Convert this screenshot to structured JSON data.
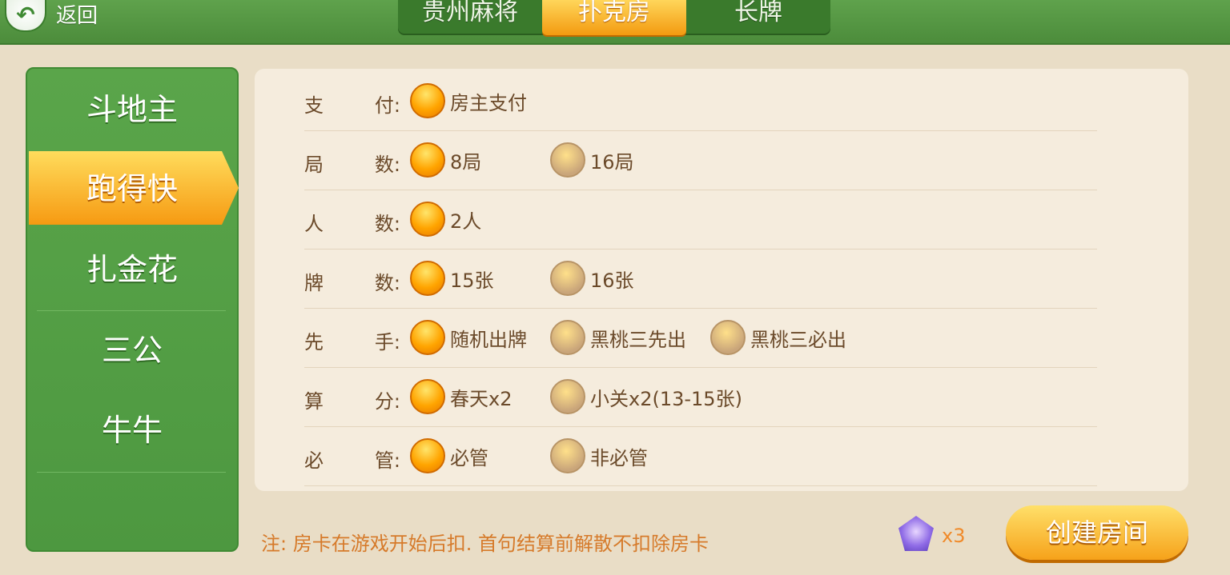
{
  "header": {
    "back_label": "返回",
    "tabs": [
      {
        "label": "贵州麻将",
        "active": false
      },
      {
        "label": "扑克房",
        "active": true
      },
      {
        "label": "长牌",
        "active": false
      }
    ]
  },
  "sidebar": {
    "items": [
      {
        "label": "斗地主",
        "active": false
      },
      {
        "label": "跑得快",
        "active": true
      },
      {
        "label": "扎金花",
        "active": false
      },
      {
        "label": "三公",
        "active": false
      },
      {
        "label": "牛牛",
        "active": false
      }
    ]
  },
  "options": {
    "pay": {
      "label_a": "支",
      "label_b": "付:",
      "opts": [
        {
          "text": "房主支付",
          "selected": true
        }
      ]
    },
    "rounds": {
      "label_a": "局",
      "label_b": "数:",
      "opts": [
        {
          "text": "8局",
          "selected": true
        },
        {
          "text": "16局",
          "selected": false
        }
      ]
    },
    "players": {
      "label_a": "人",
      "label_b": "数:",
      "opts": [
        {
          "text": "2人",
          "selected": true
        }
      ]
    },
    "cards": {
      "label_a": "牌",
      "label_b": "数:",
      "opts": [
        {
          "text": "15张",
          "selected": true
        },
        {
          "text": "16张",
          "selected": false
        }
      ]
    },
    "first": {
      "label_a": "先",
      "label_b": "手:",
      "opts": [
        {
          "text": "随机出牌",
          "selected": true
        },
        {
          "text": "黑桃三先出",
          "selected": false
        },
        {
          "text": "黑桃三必出",
          "selected": false
        }
      ]
    },
    "score": {
      "label_a": "算",
      "label_b": "分:",
      "opts": [
        {
          "text": "春天x2",
          "selected": true
        },
        {
          "text": "小关x2(13-15张)",
          "selected": false
        }
      ]
    },
    "must": {
      "label_a": "必",
      "label_b": "管:",
      "opts": [
        {
          "text": "必管",
          "selected": true
        },
        {
          "text": "非必管",
          "selected": false
        }
      ]
    }
  },
  "footer": {
    "note": "注: 房卡在游戏开始后扣. 首句结算前解散不扣除房卡",
    "card_count": "x3",
    "create_label": "创建房间"
  }
}
